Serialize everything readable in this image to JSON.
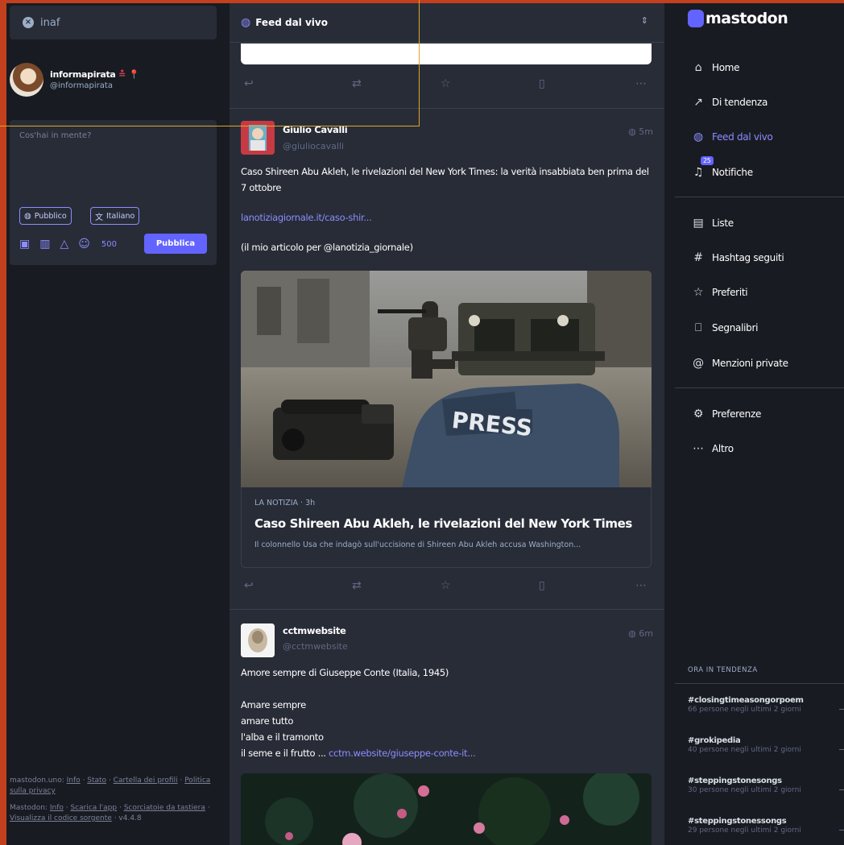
{
  "search": {
    "value": "inaf"
  },
  "profile": {
    "display_name": "informapirata",
    "badges": "≛ 📍",
    "handle": "@informapirata"
  },
  "composer": {
    "placeholder": "Cos'hai in mente?",
    "visibility_label": "Pubblico",
    "language_label": "Italiano",
    "char_count": "500",
    "publish_label": "Pubblica"
  },
  "footer": {
    "server_line": {
      "prefix": "mastodon.uno:",
      "about": "Info",
      "status": "Stato",
      "directory": "Cartella dei profili",
      "privacy": "Politica sulla privacy"
    },
    "app_line": {
      "prefix": "Mastodon:",
      "about": "Info",
      "get_app": "Scarica l'app",
      "shortcuts": "Scorciatoie da tastiera",
      "source": "Visualizza il codice sorgente",
      "version": "v4.4.8"
    }
  },
  "feed": {
    "title": "Feed dal vivo",
    "posts": [
      {
        "display_name": "Giulio Cavalli",
        "handle": "@giuliocavalli",
        "time": "5m",
        "text_main": "Caso Shireen Abu Akleh, le rivelazioni del New York Times: la verità insabbiata ben prima del 7 ottobre",
        "link": "lanotiziagiornale.it/caso-shir...",
        "text_after": "(il mio articolo per @lanotizia_giornale)",
        "card": {
          "source": "LA NOTIZIA · 3h",
          "title": "Caso Shireen Abu Akleh, le rivelazioni del New York Times",
          "description": "Il colonnello Usa che indagò sull'uccisione di Shireen Abu Akleh accusa Washington...",
          "image_text": "PRESS"
        }
      },
      {
        "display_name": "cctmwebsite",
        "handle": "@cctmwebsite",
        "time": "6m",
        "text_main": "Amore sempre di Giuseppe Conte (Italia, 1945)",
        "lines": [
          "Amare sempre",
          "amare tutto",
          "l'alba e il tramonto"
        ],
        "last_line": "il seme e il frutto ...",
        "link": "cctm.website/giuseppe-conte-it..."
      }
    ]
  },
  "nav": {
    "brand": "mastodon",
    "items": [
      {
        "label": "Home",
        "icon": "home-icon"
      },
      {
        "label": "Di tendenza",
        "icon": "trending-icon"
      },
      {
        "label": "Feed dal vivo",
        "icon": "globe-icon"
      },
      {
        "label": "Notifiche",
        "icon": "bell-icon",
        "badge": "25"
      },
      {
        "label": "Liste",
        "icon": "list-icon"
      },
      {
        "label": "Hashtag seguiti",
        "icon": "hashtag-icon"
      },
      {
        "label": "Preferiti",
        "icon": "star-icon"
      },
      {
        "label": "Segnalibri",
        "icon": "bookmark-icon"
      },
      {
        "label": "Menzioni private",
        "icon": "at-icon"
      },
      {
        "label": "Preferenze",
        "icon": "gear-icon"
      },
      {
        "label": "Altro",
        "icon": "more-icon"
      }
    ]
  },
  "trends": {
    "title": "ORA IN TENDENZA",
    "items": [
      {
        "tag": "#closingtimeasongorpoem",
        "sub": "66 persone negli ultimi 2 giorni"
      },
      {
        "tag": "#grokipedia",
        "sub": "40 persone negli ultimi 2 giorni"
      },
      {
        "tag": "#steppingstonesongs",
        "sub": "30 persone negli ultimi 2 giorni"
      },
      {
        "tag": "#steppingstonessongs",
        "sub": "29 persone negli ultimi 2 giorni"
      }
    ]
  },
  "colors": {
    "accent": "#6364ff",
    "accent_light": "#8c8dff",
    "frame": "#c2401d",
    "highlight": "#e0a528"
  }
}
